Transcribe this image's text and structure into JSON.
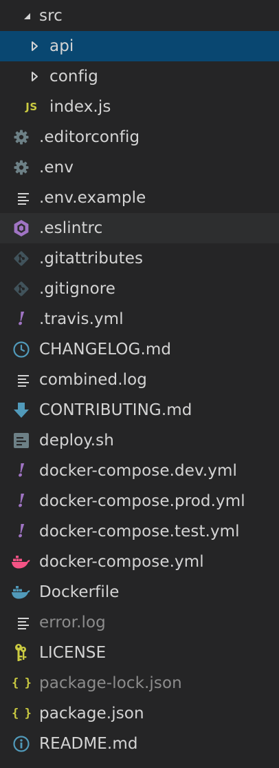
{
  "explorer": {
    "items": [
      {
        "label": "src",
        "icon": "chevron-down-icon",
        "state": "expanded-folder"
      },
      {
        "label": "api",
        "icon": "chevron-right-icon",
        "state": "selected"
      },
      {
        "label": "config",
        "icon": "chevron-right-icon",
        "state": "collapsed-folder"
      },
      {
        "label": "index.js",
        "icon": "javascript-icon",
        "icon_text": "JS"
      },
      {
        "label": ".editorconfig",
        "icon": "gear-icon"
      },
      {
        "label": ".env",
        "icon": "gear-icon"
      },
      {
        "label": ".env.example",
        "icon": "lines-icon"
      },
      {
        "label": ".eslintrc",
        "icon": "eslint-icon",
        "state": "hover"
      },
      {
        "label": ".gitattributes",
        "icon": "git-icon"
      },
      {
        "label": ".gitignore",
        "icon": "git-icon"
      },
      {
        "label": ".travis.yml",
        "icon": "yaml-icon",
        "icon_text": "!"
      },
      {
        "label": "CHANGELOG.md",
        "icon": "clock-icon"
      },
      {
        "label": "combined.log",
        "icon": "lines-icon"
      },
      {
        "label": "CONTRIBUTING.md",
        "icon": "arrow-down-icon"
      },
      {
        "label": "deploy.sh",
        "icon": "shell-icon"
      },
      {
        "label": "docker-compose.dev.yml",
        "icon": "yaml-icon",
        "icon_text": "!"
      },
      {
        "label": "docker-compose.prod.yml",
        "icon": "yaml-icon",
        "icon_text": "!"
      },
      {
        "label": "docker-compose.test.yml",
        "icon": "yaml-icon",
        "icon_text": "!"
      },
      {
        "label": "docker-compose.yml",
        "icon": "docker-icon"
      },
      {
        "label": "Dockerfile",
        "icon": "docker-icon"
      },
      {
        "label": "error.log",
        "icon": "lines-icon",
        "state": "dimmed"
      },
      {
        "label": "LICENSE",
        "icon": "key-icon"
      },
      {
        "label": "package-lock.json",
        "icon": "json-icon",
        "icon_text": "{ }",
        "state": "dimmed"
      },
      {
        "label": "package.json",
        "icon": "json-icon",
        "icon_text": "{ }"
      },
      {
        "label": "README.md",
        "icon": "info-icon"
      }
    ]
  },
  "colors": {
    "background": "#252526",
    "selected_row": "#094771",
    "text": "#d4d4d4",
    "dimmed_text": "#8c8c8c",
    "js_yellow": "#cbcb41",
    "yaml_purple": "#a074c4",
    "gear_gray": "#6d8086",
    "git_gray": "#41535b",
    "docker_pink": "#f55385",
    "docker_blue": "#519aba"
  }
}
